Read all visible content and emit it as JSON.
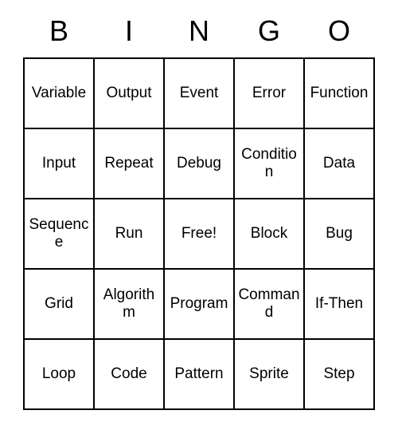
{
  "header": {
    "letters": [
      "B",
      "I",
      "N",
      "G",
      "O"
    ]
  },
  "grid": {
    "rows": [
      [
        "Variable",
        "Output",
        "Event",
        "Error",
        "Function"
      ],
      [
        "Input",
        "Repeat",
        "Debug",
        "Condition",
        "Data"
      ],
      [
        "Sequence",
        "Run",
        "Free!",
        "Block",
        "Bug"
      ],
      [
        "Grid",
        "Algorithm",
        "Program",
        "Command",
        "If-Then"
      ],
      [
        "Loop",
        "Code",
        "Pattern",
        "Sprite",
        "Step"
      ]
    ]
  }
}
